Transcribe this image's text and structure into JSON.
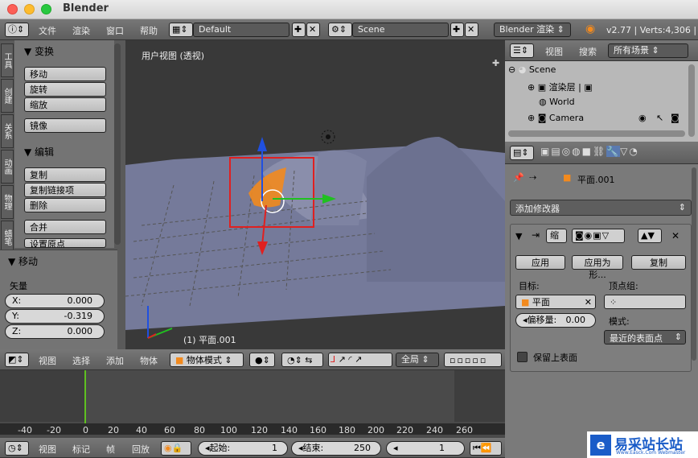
{
  "window": {
    "title": "Blender"
  },
  "info_header": {
    "menus": [
      "文件",
      "渲染",
      "窗口",
      "帮助"
    ],
    "layout": "Default",
    "scene": "Scene",
    "engine": "Blender 渲染",
    "stats": "v2.77 | Verts:4,306 |"
  },
  "toolshelf": {
    "tabs": [
      "工具",
      "创建",
      "关系",
      "动画",
      "物理",
      "蜡笔"
    ],
    "transform_title": "▼ 变换",
    "transform_buttons": [
      "移动",
      "旋转",
      "缩放"
    ],
    "mirror": "镜像",
    "edit_title": "▼ 编辑",
    "edit_buttons": [
      "复制",
      "复制链接项",
      "删除"
    ],
    "join": "合并",
    "origin": "设置原点"
  },
  "operator": {
    "title": "▼ 移动",
    "vector_label": "矢量",
    "x_label": "X:",
    "x_value": "0.000",
    "y_label": "Y:",
    "y_value": "-0.319",
    "z_label": "Z:",
    "z_value": "0.000"
  },
  "viewport": {
    "view_label": "用户视图 (透视)",
    "object_label": "(1) 平面.001"
  },
  "view3d_header": {
    "menus": [
      "视图",
      "选择",
      "添加",
      "物体"
    ],
    "mode": "物体模式",
    "orientation": "全局"
  },
  "outliner": {
    "menus": [
      "视图",
      "搜索"
    ],
    "filter": "所有场景",
    "items": [
      "Scene",
      "渲染层",
      "World",
      "Camera"
    ]
  },
  "properties": {
    "object_name": "平面.001",
    "add_modifier": "添加修改器",
    "modifier_name": "缩",
    "apply": "应用",
    "apply_as": "应用为形...",
    "copy": "复制",
    "target_label": "目标:",
    "target_value": "平面",
    "vertex_group_label": "顶点组:",
    "offset_label": "偏移量:",
    "offset_value": "0.00",
    "mode_label": "模式:",
    "mode_value": "最近的表面点",
    "keep_above": "保留上表面"
  },
  "timeline": {
    "ticks": [
      "-40",
      "-20",
      "0",
      "20",
      "40",
      "60",
      "80",
      "100",
      "120",
      "140",
      "160",
      "180",
      "200",
      "220",
      "240",
      "260"
    ],
    "menus": [
      "视图",
      "标记",
      "帧",
      "回放"
    ],
    "start_label": "起始:",
    "start_value": "1",
    "end_label": "结束:",
    "end_value": "250",
    "current": "1"
  },
  "watermark": {
    "text": "易采站长站",
    "sub": "Www.Easck.Com Webmaster"
  },
  "colors": {
    "accent_orange": "#f28a1e",
    "selection_red": "#e02020",
    "timeline_cursor": "#5fc020"
  }
}
